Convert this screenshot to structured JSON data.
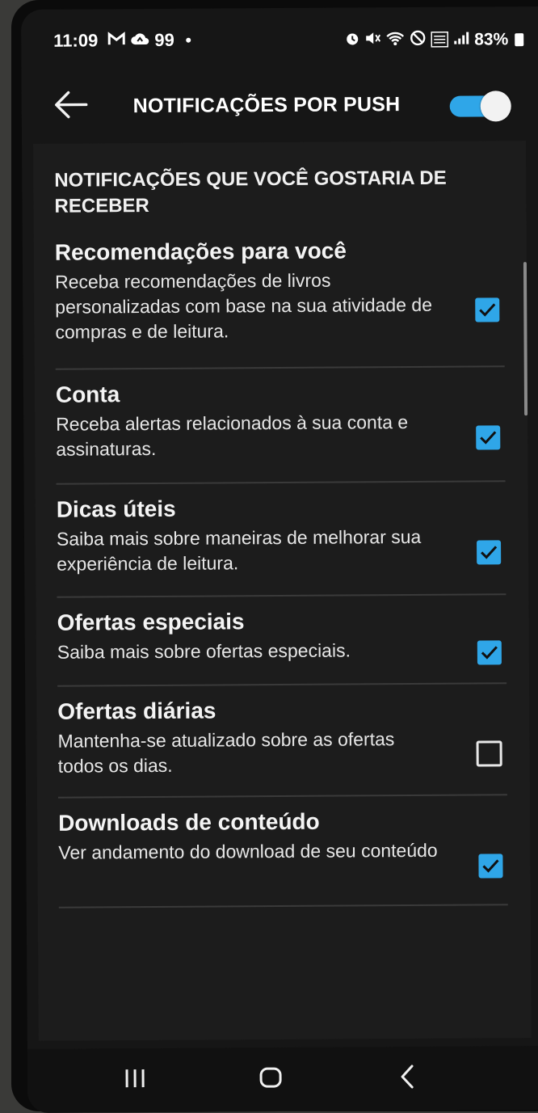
{
  "status_bar": {
    "time": "11:09",
    "left_icons": [
      "gmail-icon",
      "cloud-icon"
    ],
    "notification_count": "99",
    "battery": "83%",
    "right_icons": [
      "alarm-icon",
      "mute-icon",
      "wifi-icon",
      "dnd-icon",
      "volte-icon",
      "signal-icon",
      "battery-icon"
    ]
  },
  "app_bar": {
    "title": "NOTIFICAÇÕES POR PUSH",
    "back_icon": "arrow-left-icon",
    "master_toggle_on": true
  },
  "section": {
    "header": "NOTIFICAÇÕES QUE VOCÊ GOSTARIA DE RECEBER"
  },
  "items": [
    {
      "title": "Recomendações para você",
      "description": "Receba recomendações de livros personalizadas com base na sua atividade de compras e de leitura.",
      "checked": true
    },
    {
      "title": "Conta",
      "description": "Receba alertas relacionados à sua conta e assinaturas.",
      "checked": true
    },
    {
      "title": "Dicas úteis",
      "description": "Saiba mais sobre maneiras de melhorar sua experiência de leitura.",
      "checked": true
    },
    {
      "title": "Ofertas especiais",
      "description": "Saiba mais sobre ofertas especiais.",
      "checked": true
    },
    {
      "title": "Ofertas diárias",
      "description": "Mantenha-se atualizado sobre as ofertas todos os dias.",
      "checked": false
    },
    {
      "title": "Downloads de conteúdo",
      "description": "Ver andamento do download de seu conteúdo",
      "checked": true
    }
  ],
  "nav_bar": {
    "buttons": [
      "recent-apps-icon",
      "home-icon",
      "back-icon"
    ]
  },
  "colors": {
    "accent": "#2fa6e8",
    "background": "#1c1c1c",
    "text": "#f4f4f4"
  }
}
